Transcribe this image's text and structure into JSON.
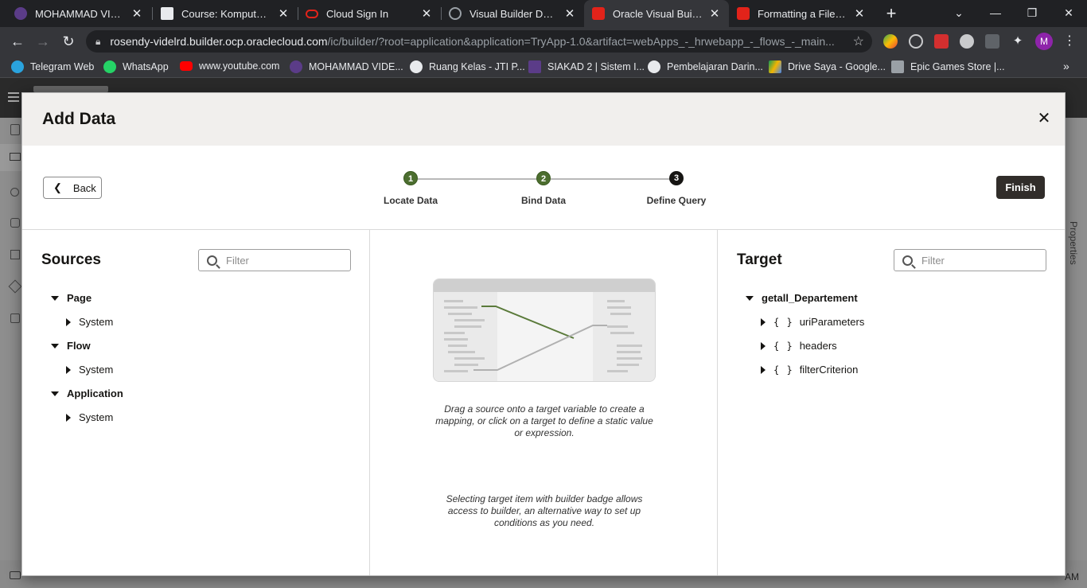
{
  "browser": {
    "tabs": [
      {
        "title": "MOHAMMAD VIDELA",
        "icon": "university-logo-icon",
        "color": "#5b3c88",
        "active": false
      },
      {
        "title": "Course: Komputasi Aw",
        "icon": "moodle-icon",
        "color": "#e8eaed",
        "active": false
      },
      {
        "title": "Cloud Sign In",
        "icon": "oracle-icon",
        "color": "#e2231a",
        "active": false
      },
      {
        "title": "Visual Builder Details",
        "icon": "globe-icon",
        "color": "#9aa0a6",
        "active": false
      },
      {
        "title": "Oracle Visual Builder |",
        "icon": "oracle-icon",
        "color": "#e2231a",
        "active": true
      },
      {
        "title": "Formatting a File for Ir",
        "icon": "oracle-icon",
        "color": "#e2231a",
        "active": false
      }
    ],
    "url_host": "rosendy-videlrd.builder.ocp.oraclecloud.com",
    "url_path": "/ic/builder/?root=application&application=TryApp-1.0&artifact=webApps_-_hrwebapp_-_flows_-_main...",
    "profile_initial": "M",
    "bookmarks": [
      {
        "label": "Telegram Web",
        "color": "#2aa3de"
      },
      {
        "label": "WhatsApp",
        "color": "#25d366"
      },
      {
        "label": "www.youtube.com",
        "color": "#ff0000"
      },
      {
        "label": "MOHAMMAD VIDE...",
        "color": "#5b3c88"
      },
      {
        "label": "Ruang Kelas - JTI P...",
        "color": "#e8eaed"
      },
      {
        "label": "SIAKAD 2 | Sistem I...",
        "color": "#5b3c88"
      },
      {
        "label": "Pembelajaran Darin...",
        "color": "#e8eaed"
      },
      {
        "label": "Drive Saya - Google...",
        "color": "#f4b400"
      },
      {
        "label": "Epic Games Store |...",
        "color": "#9aa0a6"
      }
    ]
  },
  "background_app": {
    "properties_label": "Properties",
    "time_fragment": "AM"
  },
  "modal": {
    "title": "Add Data",
    "back_label": "Back",
    "finish_label": "Finish",
    "steps": [
      {
        "number": "1",
        "label": "Locate Data",
        "state": "done"
      },
      {
        "number": "2",
        "label": "Bind Data",
        "state": "done"
      },
      {
        "number": "3",
        "label": "Define Query",
        "state": "current"
      }
    ],
    "sources": {
      "title": "Sources",
      "filter_placeholder": "Filter",
      "tree": [
        {
          "label": "Page",
          "child": "System"
        },
        {
          "label": "Flow",
          "child": "System"
        },
        {
          "label": "Application",
          "child": "System"
        }
      ]
    },
    "middle": {
      "hint1": "Drag a source onto a target variable to create a mapping, or click on a target to define a static value or expression.",
      "hint2": "Selecting target item with builder badge allows access to builder, an alternative way to set up conditions as you need."
    },
    "target": {
      "title": "Target",
      "filter_placeholder": "Filter",
      "root": "getall_Departement",
      "brace": "{ }",
      "children": [
        "uriParameters",
        "headers",
        "filterCriterion"
      ]
    }
  }
}
